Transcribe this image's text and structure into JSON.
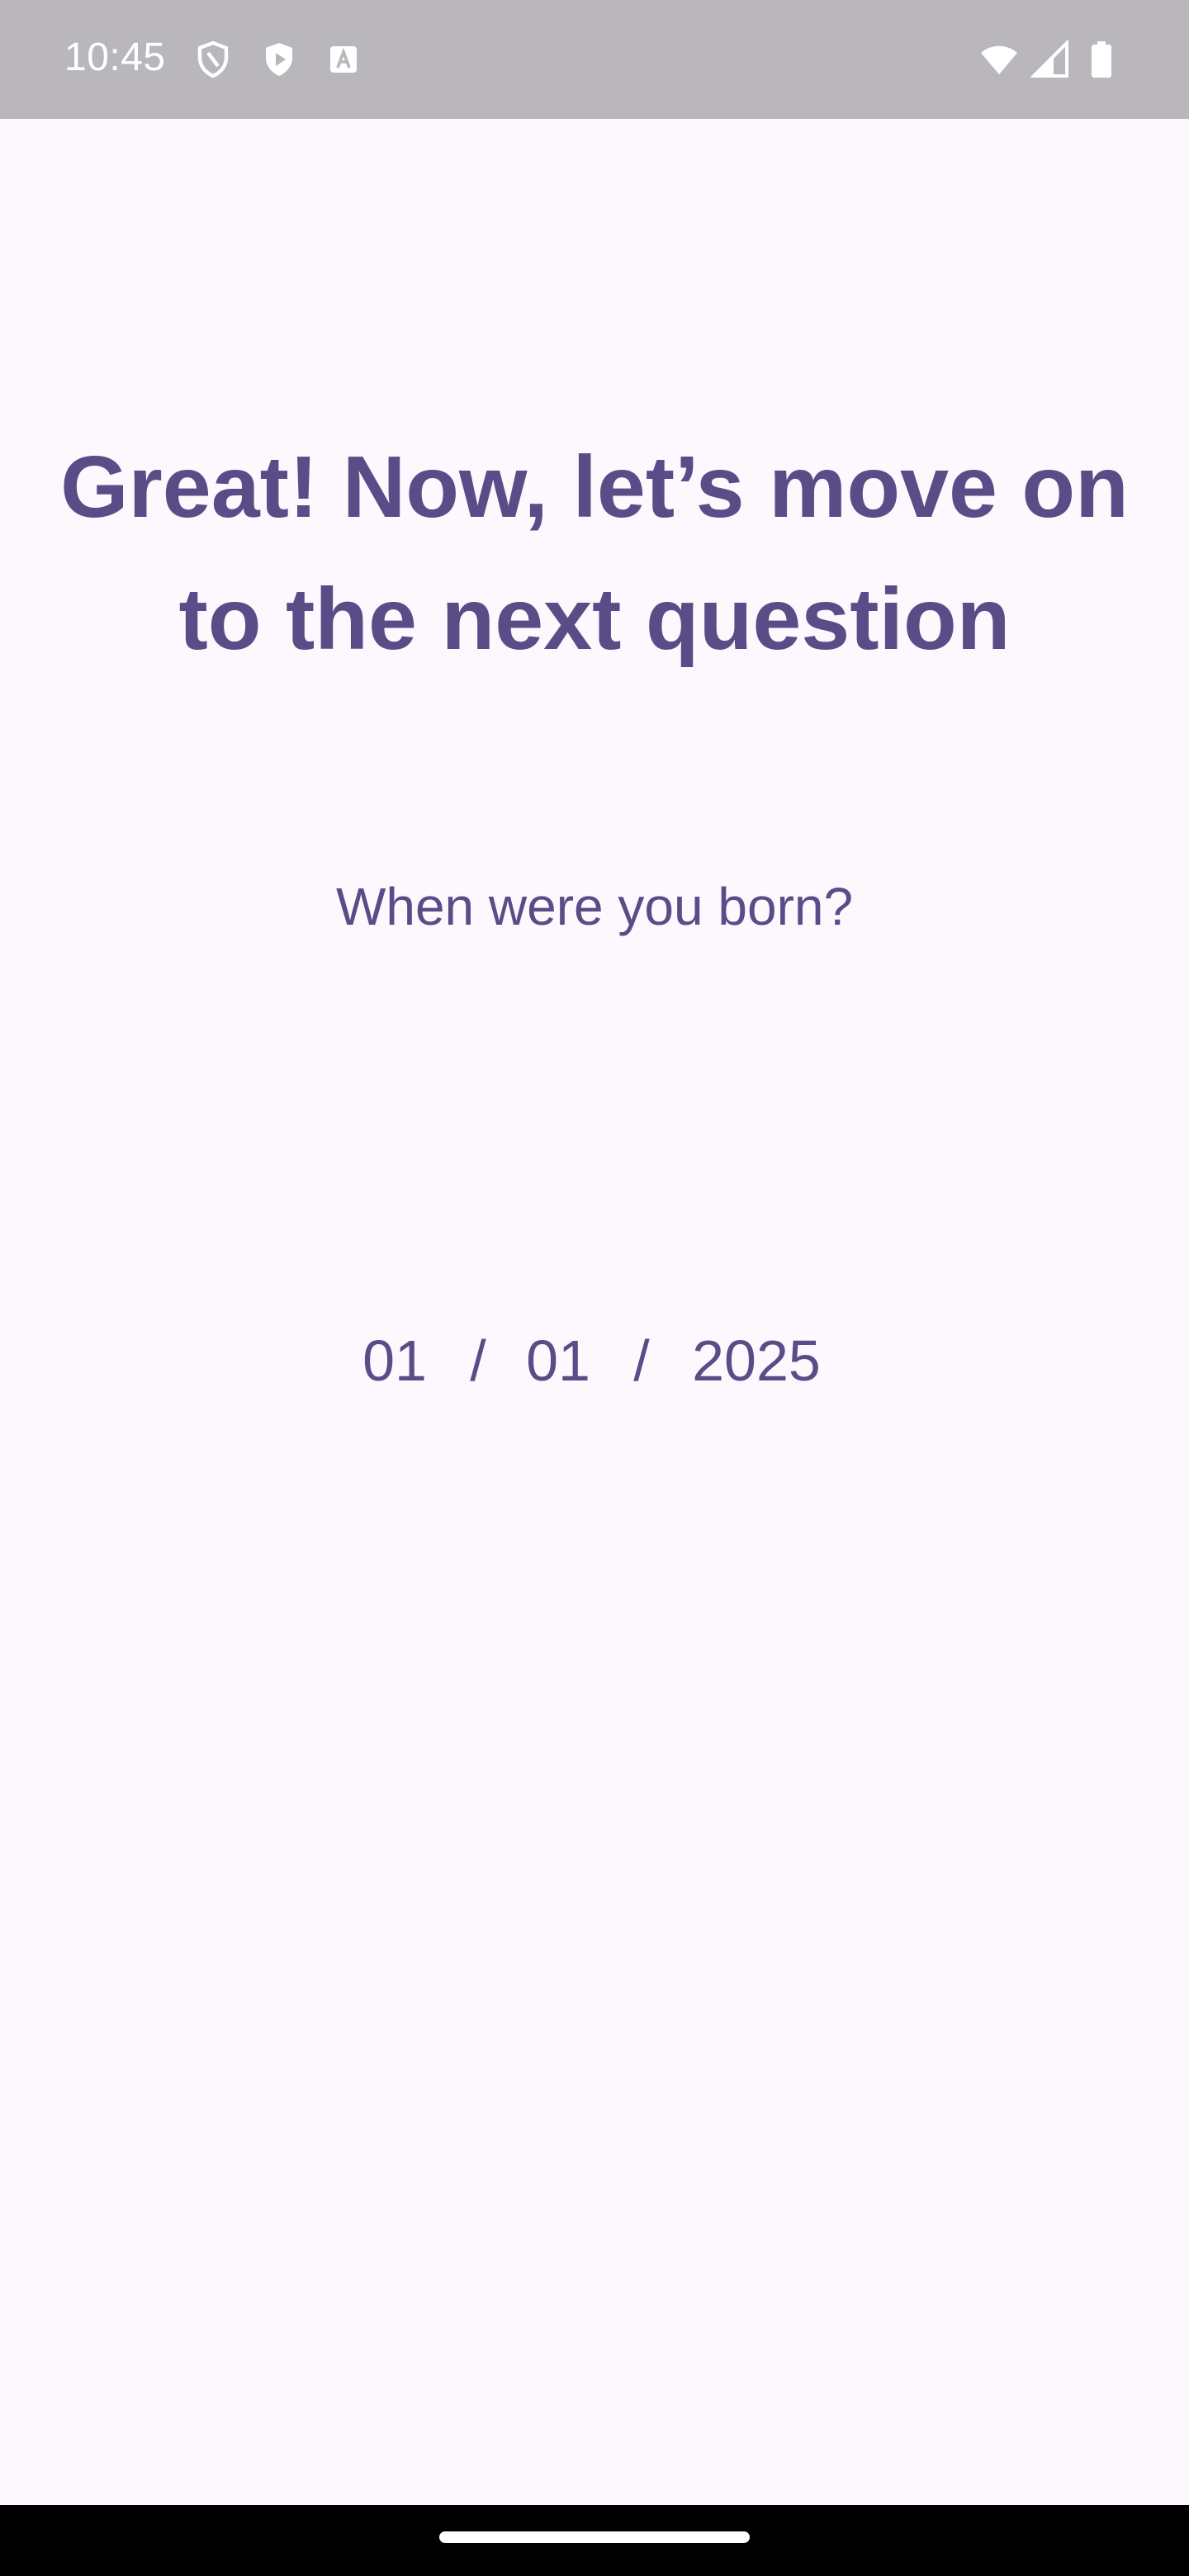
{
  "status_bar": {
    "time": "10:45",
    "icons": [
      "shield-icon",
      "play-protect-icon",
      "keyboard-a-icon",
      "wifi-icon",
      "signal-icon",
      "battery-icon"
    ]
  },
  "content": {
    "title": "Great! Now, let’s move on to the next question",
    "question": "When were you born?",
    "date": {
      "day": "01",
      "separator_1": "/",
      "month": "01",
      "separator_2": "/",
      "year": "2025"
    }
  },
  "colors": {
    "background": "#FDF7FE",
    "accent_text": "#5A4C87",
    "status_bar": "#BAB7BC",
    "nav_bar": "#000000"
  }
}
